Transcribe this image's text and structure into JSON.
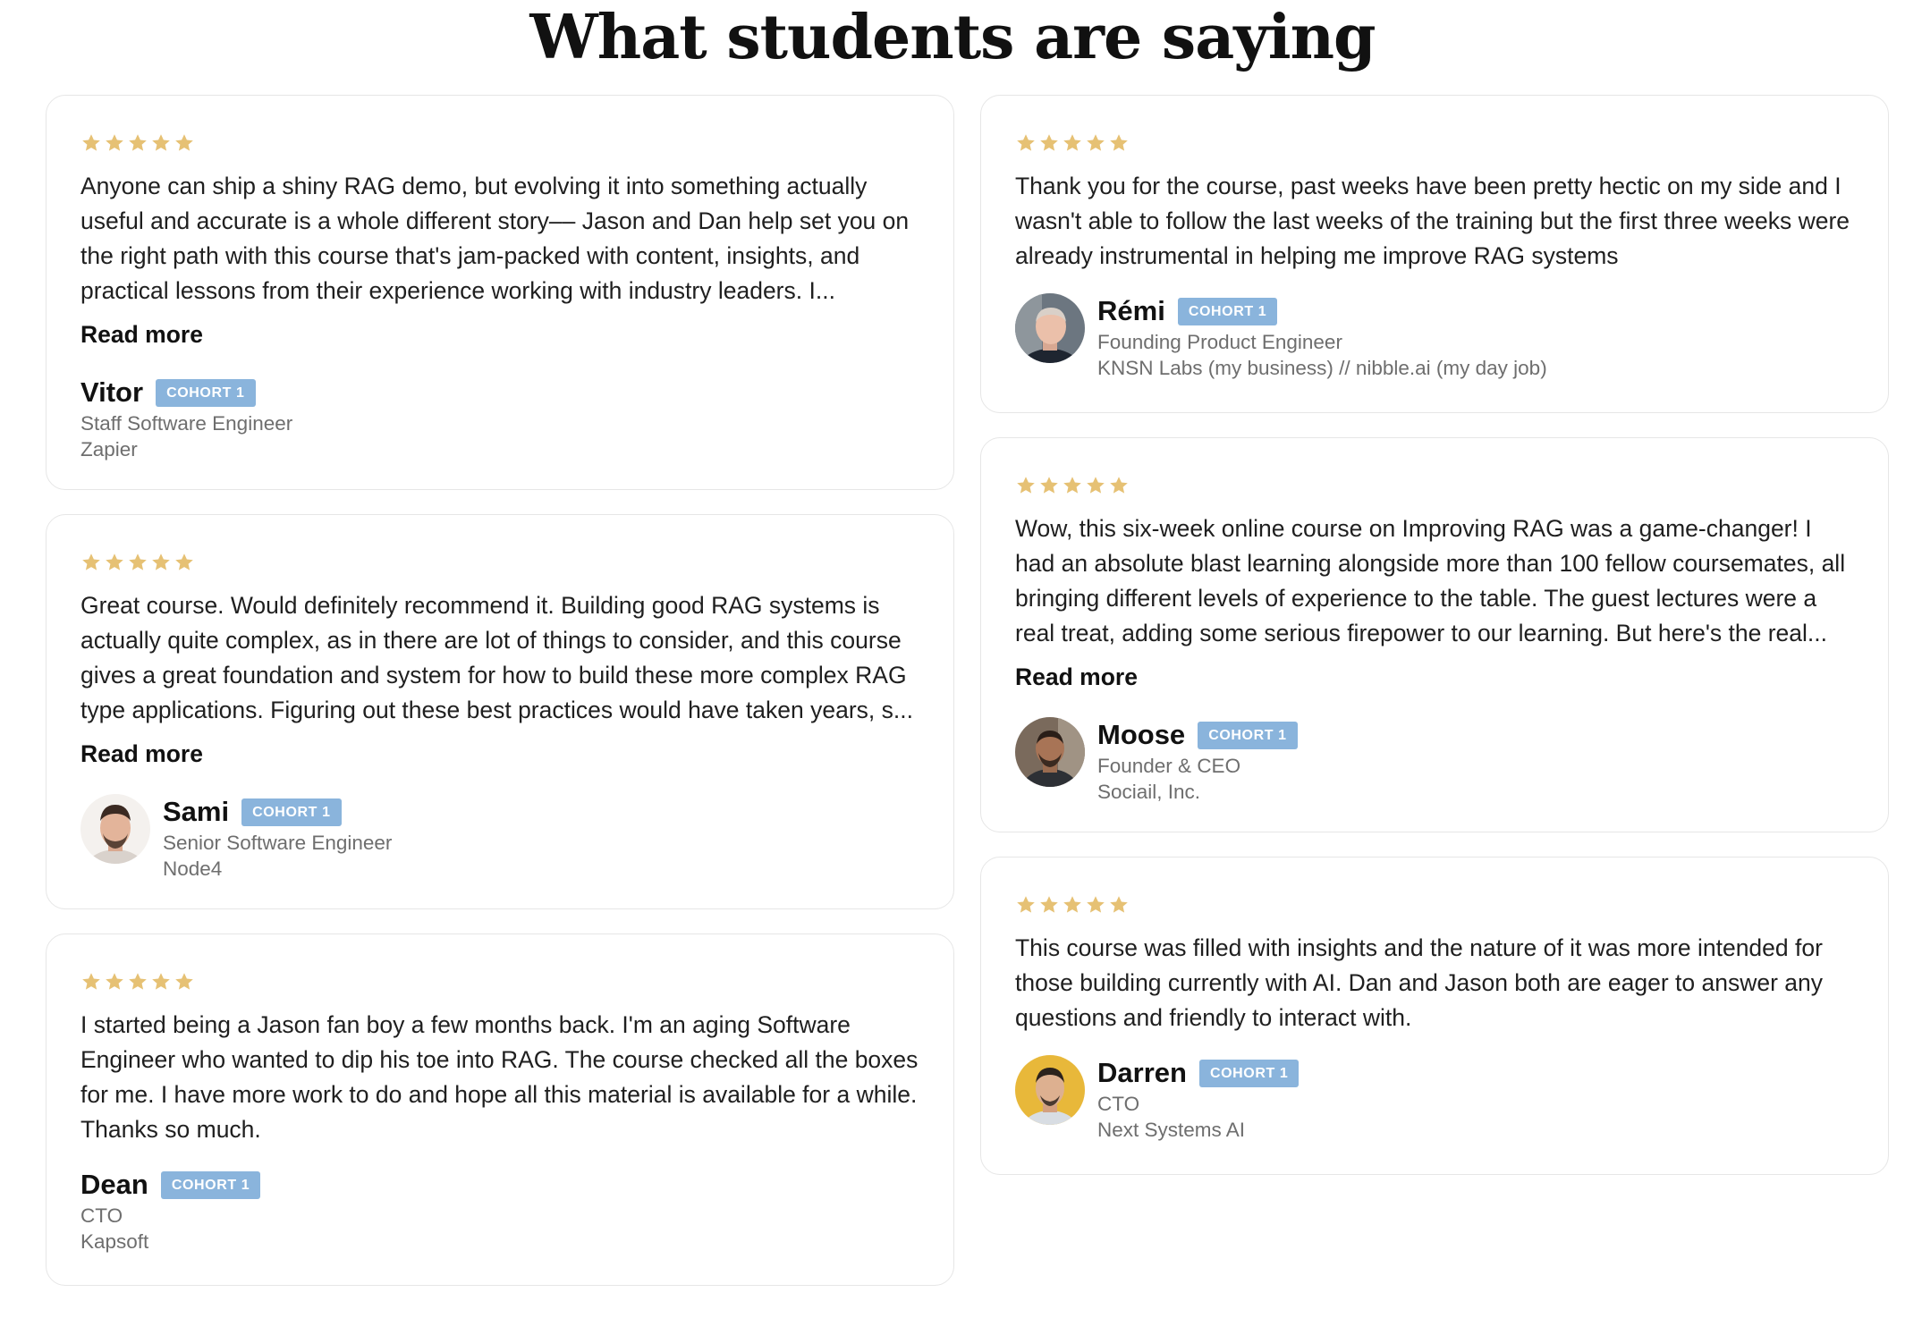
{
  "page": {
    "title": "What students are saying"
  },
  "colors": {
    "star": "#e6c174",
    "badge": "#8ab4dc",
    "border": "#e6e6e6"
  },
  "icons": {
    "rating": "star-icon"
  },
  "reviews": [
    {
      "rating": 5,
      "text": "Anyone can ship a shiny RAG demo, but evolving it into something actually useful and accurate is a whole different story–– Jason and Dan help set you on the right path with this course that's jam-packed with content, insights, and practical lessons from their experience working with industry leaders. I...",
      "read_more": "Read more",
      "name": "Vitor",
      "badge": "COHORT 1",
      "role": "Staff Software Engineer",
      "company": "Zapier"
    },
    {
      "rating": 5,
      "text": "Great course. Would definitely recommend it. Building good RAG systems is actually quite complex, as in there are lot of things to consider, and this course gives a great foundation and system for how to build these more complex RAG type applications. Figuring out these best practices would have taken years, s...",
      "read_more": "Read more",
      "name": "Sami",
      "badge": "COHORT 1",
      "role": "Senior Software Engineer",
      "company": "Node4"
    },
    {
      "rating": 5,
      "text": "I started being a Jason fan boy a few months back. I'm an aging Software Engineer who wanted to dip his toe into RAG. The course checked all the boxes for me. I have more work to do and hope all this material is available for a while. Thanks so much.",
      "name": "Dean",
      "badge": "COHORT 1",
      "role": "CTO",
      "company": "Kapsoft"
    },
    {
      "rating": 5,
      "text": "Thank you for the course, past weeks have been pretty hectic on my side and I wasn't able to follow the last weeks of the training but the first three weeks were already instrumental in helping me improve RAG systems",
      "name": "Rémi",
      "badge": "COHORT 1",
      "role": "Founding Product Engineer",
      "company": "KNSN Labs (my business) // nibble.ai (my day job)"
    },
    {
      "rating": 5,
      "text": "Wow, this six-week online course on Improving RAG was a game-changer! I had an absolute blast learning alongside more than 100 fellow coursemates, all bringing different levels of experience to the table. The guest lectures were a real treat, adding some serious firepower to our learning. But here's the real...",
      "read_more": "Read more",
      "name": "Moose",
      "badge": "COHORT 1",
      "role": "Founder & CEO",
      "company": "Sociail, Inc."
    },
    {
      "rating": 5,
      "text": "This course was filled with insights and the nature of it was more intended for those building currently with AI. Dan and Jason both are eager to answer any questions and friendly to interact with.",
      "name": "Darren",
      "badge": "COHORT 1",
      "role": "CTO",
      "company": "Next Systems AI"
    }
  ]
}
